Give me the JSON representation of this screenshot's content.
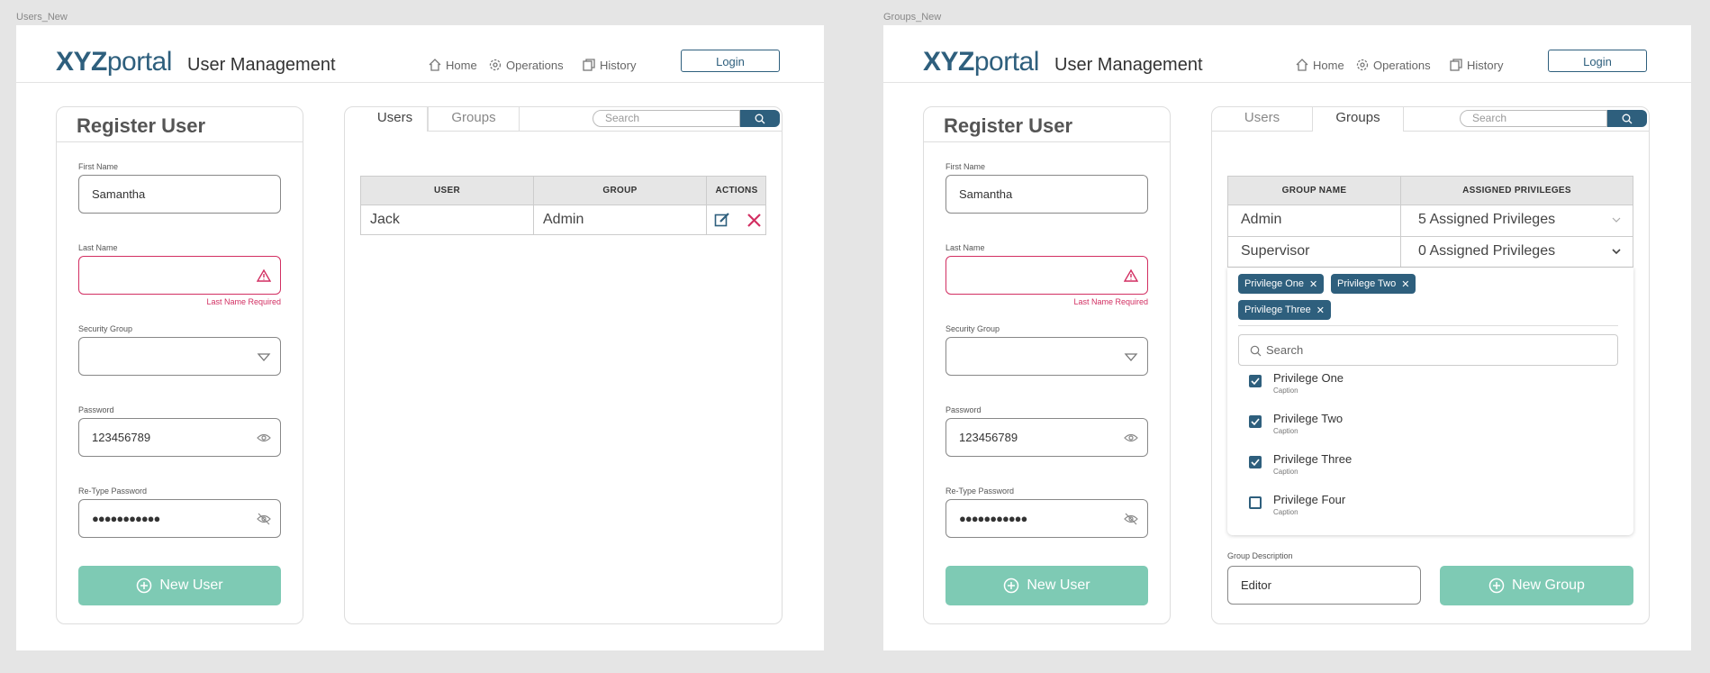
{
  "frames": [
    {
      "label": "Users_New"
    },
    {
      "label": "Groups_New"
    }
  ],
  "header": {
    "logo_bold": "XYZ",
    "logo_light": "portal",
    "title": "User Management",
    "nav": [
      {
        "label": "Home",
        "icon": "home-icon"
      },
      {
        "label": "Operations",
        "icon": "gear-icon"
      },
      {
        "label": "History",
        "icon": "history-icon"
      }
    ],
    "login_label": "Login"
  },
  "register": {
    "title": "Register User",
    "first_name_label": "First Name",
    "first_name_value": "Samantha",
    "last_name_label": "Last Name",
    "last_name_value": "",
    "last_name_error": "Last Name Required",
    "security_group_label": "Security Group",
    "security_group_value": "",
    "password_label": "Password",
    "password_value": "123456789",
    "retype_label": "Re-Type Password",
    "retype_value": "●●●●●●●●●●●",
    "new_user_label": "New User"
  },
  "tabs": [
    "Users",
    "Groups"
  ],
  "search_placeholder": "Search",
  "users_table": {
    "headers": [
      "USER",
      "GROUP",
      "ACTIONS"
    ],
    "rows": [
      {
        "user": "Jack",
        "group": "Admin"
      }
    ]
  },
  "groups_table": {
    "headers": [
      "GROUP NAME",
      "ASSIGNED PRIVILEGES"
    ],
    "rows": [
      {
        "name": "Admin",
        "privileges": "5 Assigned Privileges"
      },
      {
        "name": "Supervisor",
        "privileges": "0 Assigned Privileges"
      }
    ]
  },
  "privilege_dropdown": {
    "chips": [
      "Privilege One",
      "Privilege Two",
      "Privilege Three"
    ],
    "search_placeholder": "Search",
    "options": [
      {
        "label": "Privilege One",
        "caption": "Caption",
        "checked": true
      },
      {
        "label": "Privilege Two",
        "caption": "Caption",
        "checked": true
      },
      {
        "label": "Privilege Three",
        "caption": "Caption",
        "checked": true
      },
      {
        "label": "Privilege Four",
        "caption": "Caption",
        "checked": false
      }
    ]
  },
  "group_form": {
    "description_label": "Group Description",
    "description_value": "Editor",
    "new_group_label": "New Group"
  },
  "colors": {
    "brand": "#2e5f7d",
    "accent": "#7ecab4",
    "error": "#d22f62"
  }
}
